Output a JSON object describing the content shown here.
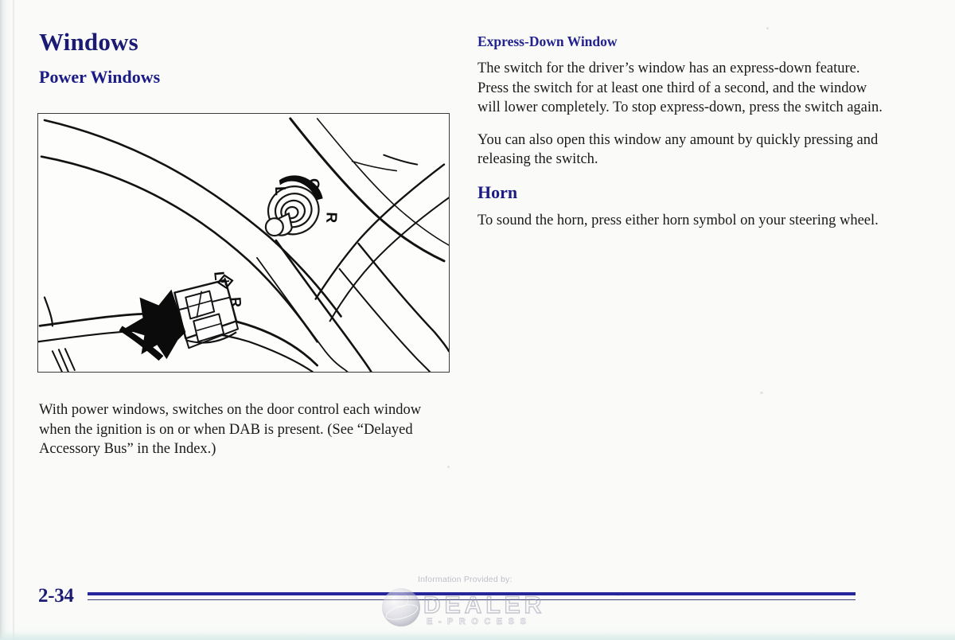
{
  "document": {
    "page_number": "2-34",
    "heading_color": "#1b1b74",
    "subheading_color": "#22228f",
    "rule_color": "#26269a",
    "body_color": "#1a1a1a",
    "paper_color": "#fafaf9"
  },
  "left_column": {
    "title": "Windows",
    "subtitle": "Power Windows",
    "figure": {
      "name": "door-control-panel-illustration",
      "alt": "Line drawing of a car door armrest showing the mirror control knob and power window switches with an arrow pointing to the switches",
      "labels": {
        "mirror_left": "L",
        "mirror_off": "O",
        "mirror_right": "R",
        "window_left": "L",
        "window_symbol": "⊕",
        "window_right": "R"
      }
    },
    "caption": "With power windows, switches on the door control each window when the ignition is on or when DAB is present. (See “Delayed Accessory Bus” in the Index.)"
  },
  "right_column": {
    "sections": [
      {
        "heading": "Express-Down Window",
        "paragraphs": [
          "The switch for the driver’s window has an express-down feature. Press the switch for at least one third of a second, and the window will lower completely. To stop express-down, press the switch again.",
          "You can also open this window any amount by quickly pressing and releasing the switch."
        ]
      },
      {
        "heading": "Horn",
        "paragraphs": [
          "To sound the horn, press either horn symbol on your steering wheel."
        ]
      }
    ]
  },
  "watermark": {
    "provided_by": "Information Provided by:",
    "brand": "DEALER",
    "tagline": "E-PROCESS",
    "icon": "globe-icon"
  }
}
